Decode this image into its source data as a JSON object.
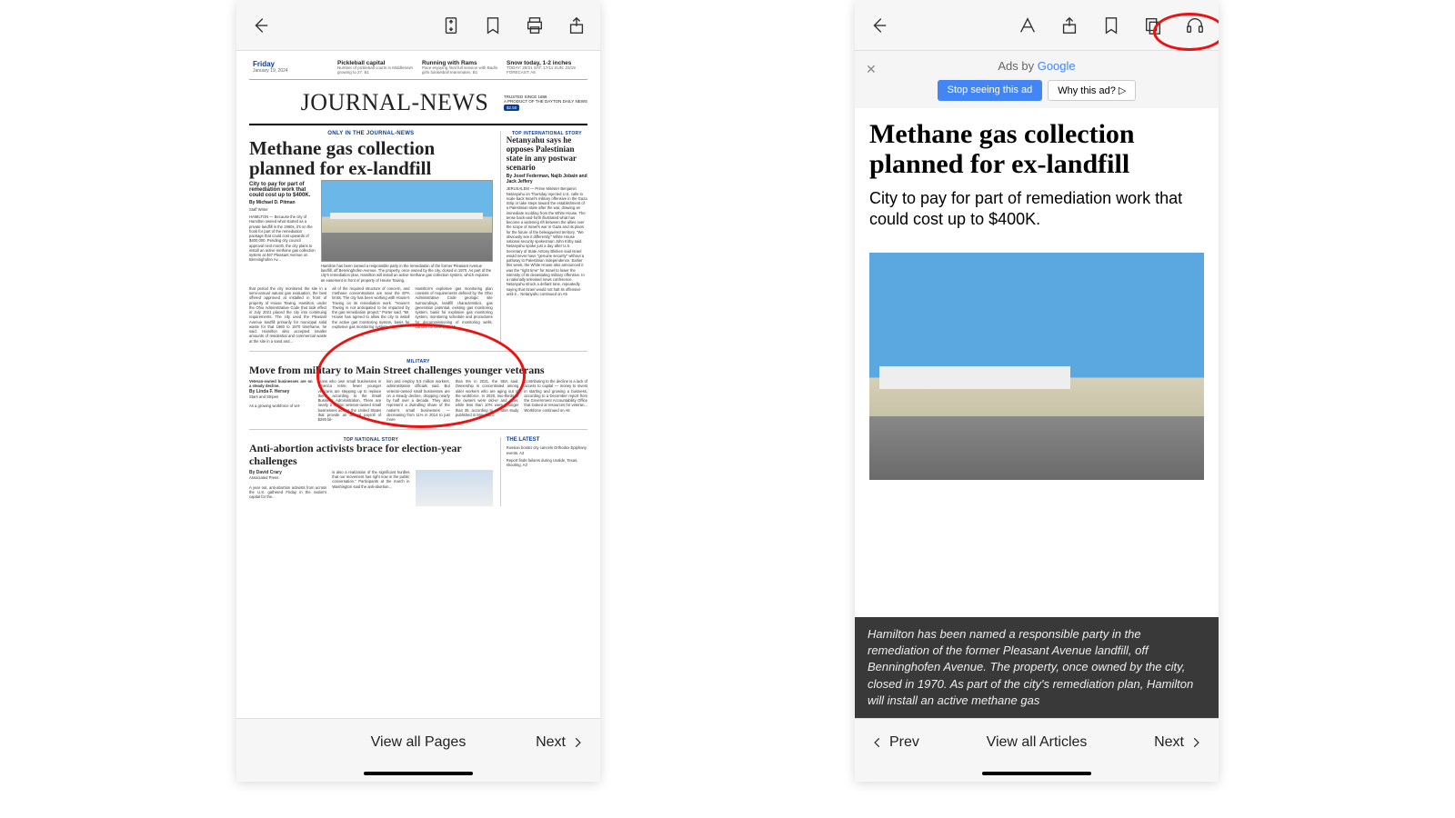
{
  "left": {
    "topbar": {
      "back": "back"
    },
    "bottom": {
      "center": "View all Pages",
      "next": "Next"
    },
    "paper": {
      "day": "Friday",
      "date": "January 19, 2024",
      "teasers": [
        {
          "h": "Pickleball capital",
          "p": "Number of pickleball courts in Middletown growing to 27. B1"
        },
        {
          "h": "Running with Rams",
          "p": "Pace enjoying final full session with Badin girls basketball teammates. B1"
        },
        {
          "h": "Snow today, 1-2 inches",
          "p": "TODAY: 29/21 SAT: 17/11 SUN: 23/19 FORECAST: A8"
        }
      ],
      "masthead": "JOURNAL-NEWS",
      "trusted": "TRUSTED SINCE 1886",
      "product": "A PRODUCT OF THE DAYTON DAILY NEWS",
      "price": "$2.50",
      "kicker": "ONLY IN THE JOURNAL-NEWS",
      "h1": "Methane gas collection planned for ex-landfill",
      "sub": "City to pay for part of remediation work that could cost up to $400K.",
      "byline": "By Michael D. Pitman",
      "byorg": "Staff Writer",
      "caption": "Hamilton has been named a responsible party in the remediation of the former Pleasant Avenue landfill, off Benninghofen Avenue. The property, once owned by the city, closed in 1970. As part of the city's remediation plan, Hamilton will install an active methane gas collection system, which requires an easement in front of property of House Towing.",
      "sideKicker": "TOP INTERNATIONAL STORY",
      "sideH": "Netanyahu says he opposes Palestinian state in any postwar scenario",
      "sideBy": "By Josef Federman, Najib Jobain and Jack Jeffery",
      "story2kick": "MILITARY",
      "story2h": "Move from military to Main Street challenges younger veterans",
      "story2sub": "Veteran-owned businesses are on a steady decline.",
      "story2by": "By Linda F. Hersey",
      "story3kick": "TOP NATIONAL STORY",
      "story3h": "Anti-abortion activists brace for election-year challenges",
      "story3by": "By David Crary",
      "latest": "THE LATEST",
      "latest1": "Russian border city cancels Orthodox Epiphany events. A2",
      "latest2": "Report finds failures during Uvalde, Texas, shooting. A3"
    }
  },
  "right": {
    "ad": {
      "text": "Ads by ",
      "google": "Google",
      "stop": "Stop seeing this ad",
      "why": "Why this ad? ▷"
    },
    "article": {
      "h1": "Methane gas collection planned for ex-landfill",
      "sub": "City to pay for part of remediation work that could cost up to $400K.",
      "caption": "Hamilton has been named a responsible party in the remediation of the former Pleasant Avenue landfill, off Benninghofen Avenue. The property, once owned by the city, closed in 1970. As part of the city's remediation plan, Hamilton will install an active methane gas"
    },
    "bottom": {
      "prev": "Prev",
      "center": "View all Articles",
      "next": "Next"
    }
  }
}
